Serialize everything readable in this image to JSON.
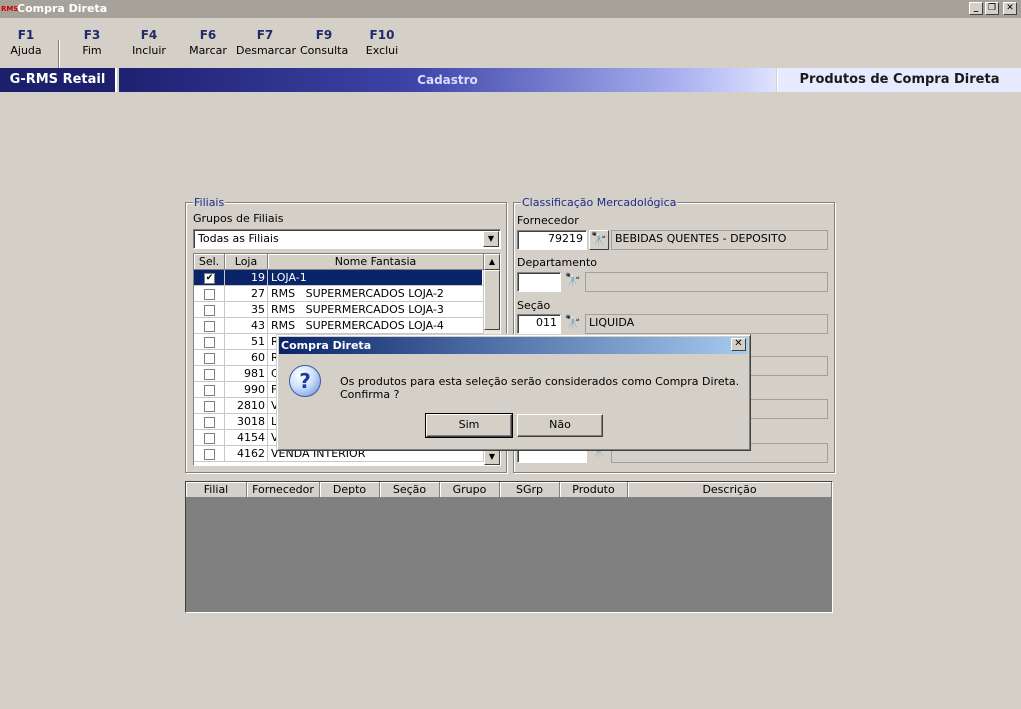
{
  "window": {
    "title": "Compra Direta",
    "app_icon": "RMS"
  },
  "fkeys": [
    {
      "key": "F1",
      "label": "Ajuda"
    },
    {
      "key": "F3",
      "label": "Fim"
    },
    {
      "key": "F4",
      "label": "Incluir"
    },
    {
      "key": "F6",
      "label": "Marcar"
    },
    {
      "key": "F7",
      "label": "Desmarcar"
    },
    {
      "key": "F9",
      "label": "Consulta"
    },
    {
      "key": "F10",
      "label": "Exclui"
    }
  ],
  "banner": {
    "brand": "G-RMS Retail",
    "section": "Cadastro",
    "screen": "Produtos de Compra Direta"
  },
  "filiais": {
    "title": "Filiais",
    "grupos_label": "Grupos de Filiais",
    "grupos_value": "Todas as Filiais",
    "columns": [
      "Sel.",
      "Loja",
      "Nome Fantasia"
    ],
    "rows": [
      {
        "checked": true,
        "loja": "19",
        "nome": "LOJA-1"
      },
      {
        "checked": false,
        "loja": "27",
        "nome": "RMS   SUPERMERCADOS LOJA-2"
      },
      {
        "checked": false,
        "loja": "35",
        "nome": "RMS   SUPERMERCADOS LOJA-3"
      },
      {
        "checked": false,
        "loja": "43",
        "nome": "RMS   SUPERMERCADOS LOJA-4"
      },
      {
        "checked": false,
        "loja": "51",
        "nome": "R"
      },
      {
        "checked": false,
        "loja": "60",
        "nome": "R"
      },
      {
        "checked": false,
        "loja": "981",
        "nome": "C"
      },
      {
        "checked": false,
        "loja": "990",
        "nome": "F"
      },
      {
        "checked": false,
        "loja": "2810",
        "nome": "V"
      },
      {
        "checked": false,
        "loja": "3018",
        "nome": "L"
      },
      {
        "checked": false,
        "loja": "4154",
        "nome": "V"
      },
      {
        "checked": false,
        "loja": "4162",
        "nome": "VENDA INTERIOR"
      }
    ]
  },
  "classificacao": {
    "title": "Classificação Mercadológica",
    "fornecedor": {
      "label": "Fornecedor",
      "code": "79219",
      "desc": "BEBIDAS QUENTES - DEPOSITO"
    },
    "departamento": {
      "label": "Departamento",
      "code": "",
      "desc": ""
    },
    "secao": {
      "label": "Seção",
      "code": "011",
      "desc": "LIQUIDA"
    }
  },
  "bottom_grid": {
    "columns": [
      "Filial",
      "Fornecedor",
      "Depto",
      "Seção",
      "Grupo",
      "SGrp",
      "Produto",
      "Descrição"
    ]
  },
  "dialog": {
    "title": "Compra Direta",
    "message": "Os produtos para esta seleção serão considerados como Compra Direta. Confirma ?",
    "yes": "Sim",
    "no": "Não"
  }
}
